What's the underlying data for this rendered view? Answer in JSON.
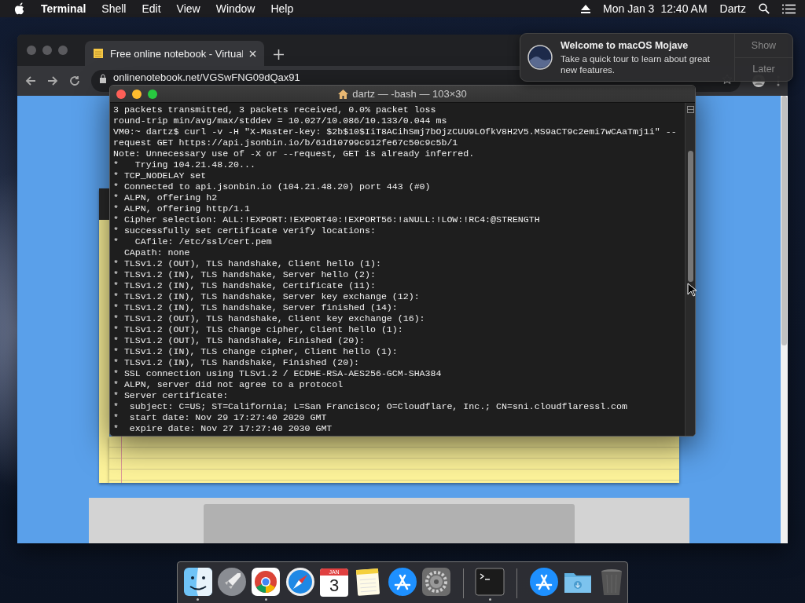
{
  "menu_bar": {
    "app": "Terminal",
    "menus": [
      "Shell",
      "Edit",
      "View",
      "Window",
      "Help"
    ],
    "date": "Mon Jan 3",
    "time": "12:40 AM",
    "user": "Dartz"
  },
  "browser": {
    "tabs": [
      {
        "title": "Free online notebook - Virtual",
        "selected": true
      }
    ],
    "url": "onlinenotebook.net/VGSwFNG09dQax91"
  },
  "terminal": {
    "title": "dartz — -bash — 103×30",
    "lines": [
      "3 packets transmitted, 3 packets received, 0.0% packet loss",
      "round-trip min/avg/max/stddev = 10.027/10.086/10.133/0.044 ms",
      "VM0:~ dartz$ curl -v -H \"X-Master-key: $2b$10$IiT8ACihSmj7bOjzCUU9LOfkV8H2V5.MS9aCT9c2emi7wCAaTmj1i\" --",
      "request GET https://api.jsonbin.io/b/61d10799c912fe67c50c9c5b/1",
      "Note: Unnecessary use of -X or --request, GET is already inferred.",
      "*   Trying 104.21.48.20...",
      "* TCP_NODELAY set",
      "* Connected to api.jsonbin.io (104.21.48.20) port 443 (#0)",
      "* ALPN, offering h2",
      "* ALPN, offering http/1.1",
      "* Cipher selection: ALL:!EXPORT:!EXPORT40:!EXPORT56:!aNULL:!LOW:!RC4:@STRENGTH",
      "* successfully set certificate verify locations:",
      "*   CAfile: /etc/ssl/cert.pem",
      "  CApath: none",
      "* TLSv1.2 (OUT), TLS handshake, Client hello (1):",
      "* TLSv1.2 (IN), TLS handshake, Server hello (2):",
      "* TLSv1.2 (IN), TLS handshake, Certificate (11):",
      "* TLSv1.2 (IN), TLS handshake, Server key exchange (12):",
      "* TLSv1.2 (IN), TLS handshake, Server finished (14):",
      "* TLSv1.2 (OUT), TLS handshake, Client key exchange (16):",
      "* TLSv1.2 (OUT), TLS change cipher, Client hello (1):",
      "* TLSv1.2 (OUT), TLS handshake, Finished (20):",
      "* TLSv1.2 (IN), TLS change cipher, Client hello (1):",
      "* TLSv1.2 (IN), TLS handshake, Finished (20):",
      "* SSL connection using TLSv1.2 / ECDHE-RSA-AES256-GCM-SHA384",
      "* ALPN, server did not agree to a protocol",
      "* Server certificate:",
      "*  subject: C=US; ST=California; L=San Francisco; O=Cloudflare, Inc.; CN=sni.cloudflaressl.com",
      "*  start date: Nov 29 17:27:40 2020 GMT",
      "*  expire date: Nov 27 17:27:40 2030 GMT"
    ]
  },
  "notification": {
    "title": "Welcome to macOS Mojave",
    "body": "Take a quick tour to learn about great new features.",
    "actions": [
      "Show",
      "Later"
    ]
  },
  "dock": {
    "items": [
      {
        "kind": "finder",
        "running": true
      },
      {
        "kind": "launchpad",
        "running": false
      },
      {
        "kind": "browser",
        "running": true
      },
      {
        "kind": "compass",
        "running": false
      },
      {
        "kind": "calendar",
        "running": false,
        "month": "JAN",
        "day": "3"
      },
      {
        "kind": "notes",
        "running": false
      },
      {
        "kind": "appstore",
        "running": false
      },
      {
        "kind": "preferences",
        "running": false
      },
      {
        "kind": "separator"
      },
      {
        "kind": "terminal",
        "running": true
      },
      {
        "kind": "separator"
      },
      {
        "kind": "appstore",
        "running": false
      },
      {
        "kind": "folder",
        "running": false
      },
      {
        "kind": "trash",
        "running": false
      }
    ]
  }
}
